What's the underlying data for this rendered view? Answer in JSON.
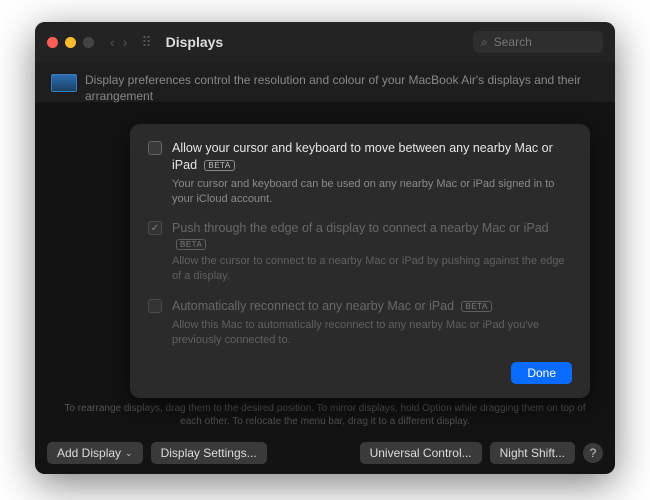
{
  "window": {
    "title": "Displays",
    "search_placeholder": "Search"
  },
  "description": "Display preferences control the resolution and colour of your MacBook Air's displays and their arrangement",
  "hint": "To rearrange displays, drag them to the desired position. To mirror displays, hold Option while dragging them on top of each other. To relocate the menu bar, drag it to a different display.",
  "buttons": {
    "add_display": "Add Display",
    "display_settings": "Display Settings...",
    "universal_control": "Universal Control...",
    "night_shift": "Night Shift...",
    "done": "Done"
  },
  "beta_label": "BETA",
  "options": [
    {
      "title": "Allow your cursor and keyboard to move between any nearby Mac or iPad",
      "sub": "Your cursor and keyboard can be used on any nearby Mac or iPad signed in to your iCloud account.",
      "checked": false,
      "disabled": false
    },
    {
      "title": "Push through the edge of a display to connect a nearby Mac or iPad",
      "sub": "Allow the cursor to connect to a nearby Mac or iPad by pushing against the edge of a display.",
      "checked": true,
      "disabled": true
    },
    {
      "title": "Automatically reconnect to any nearby Mac or iPad",
      "sub": "Allow this Mac to automatically reconnect to any nearby Mac or iPad you've previously connected to.",
      "checked": false,
      "disabled": true
    }
  ]
}
